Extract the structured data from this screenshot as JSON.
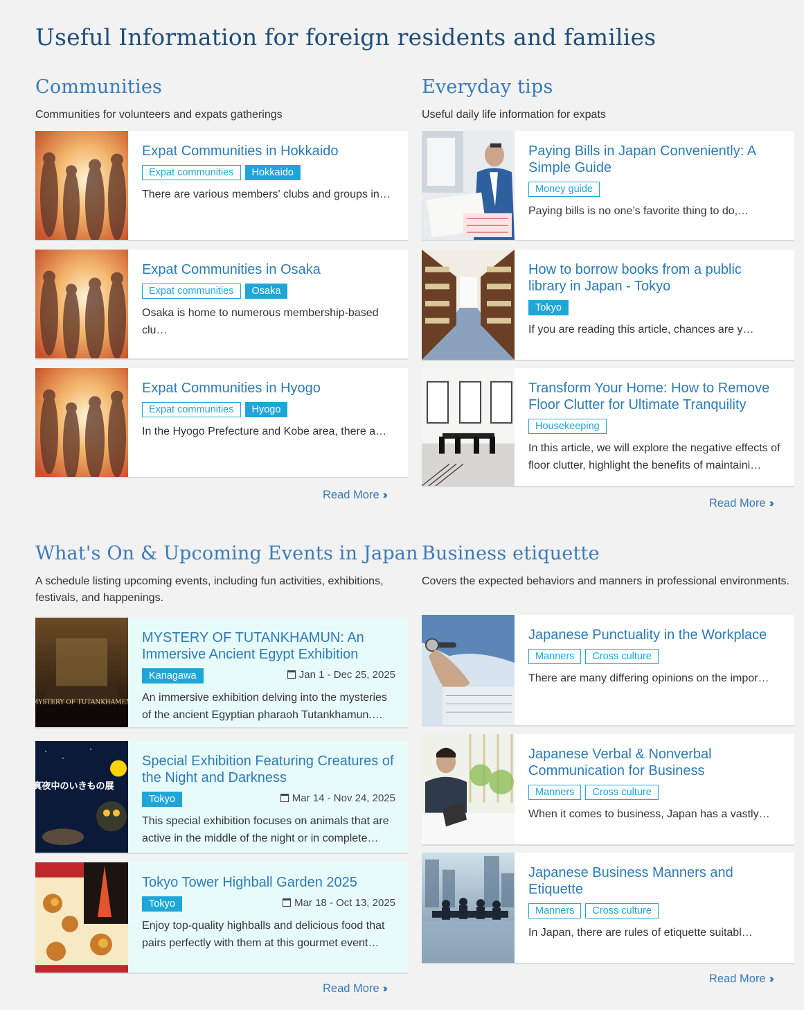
{
  "page": {
    "title": "Useful Information for foreign residents and families"
  },
  "communities": {
    "title": "Communities",
    "desc": "Communities for volunteers and expats gatherings",
    "cards": [
      {
        "title": "Expat Communities in Hokkaido",
        "tags": [
          "Expat communities",
          "Hokkaido"
        ],
        "excerpt": "There are various members' clubs and groups in…"
      },
      {
        "title": "Expat Communities in Osaka",
        "tags": [
          "Expat communities",
          "Osaka"
        ],
        "excerpt": "Osaka is home to numerous membership-based clu…"
      },
      {
        "title": "Expat Communities in Hyogo",
        "tags": [
          "Expat communities",
          "Hyogo"
        ],
        "excerpt": "In the Hyogo Prefecture and Kobe area, there a…"
      }
    ],
    "read_more": "Read More"
  },
  "tips": {
    "title": "Everyday tips",
    "desc": "Useful daily life information for expats",
    "cards": [
      {
        "title": "Paying Bills in Japan Conveniently: A Simple Guide",
        "tags": [
          "Money guide"
        ],
        "excerpt": "Paying bills is no one’s favorite thing to do,…"
      },
      {
        "title": "How to borrow books from a public library in Japan - Tokyo",
        "tags": [
          "Tokyo"
        ],
        "excerpt": "If you are reading this article, chances are y…"
      },
      {
        "title": "Transform Your Home: How to Remove Floor Clutter for Ultimate Tranquility",
        "tags": [
          "Housekeeping"
        ],
        "excerpt": "In this article, we will explore the negative effects of floor clutter, highlight the benefits of maintaini…"
      }
    ],
    "read_more": "Read More"
  },
  "events": {
    "title": "What's On & Upcoming Events in Japan",
    "desc": "A schedule listing upcoming events, including fun activities, exhibitions, festivals, and happenings.",
    "cards": [
      {
        "title": "MYSTERY OF TUTANKHAMUN: An Immersive Ancient Egypt Exhibition",
        "tags": [
          "Kanagawa"
        ],
        "date": "Jan 1 - Dec 25, 2025",
        "excerpt": "An immersive exhibition delving into the mysteries of the ancient Egyptian pharaoh Tutankhamun.…",
        "image_text": "MYSTERY OF TUTANKHAMEN"
      },
      {
        "title": "Special Exhibition Featuring Creatures of the Night and Darkness",
        "tags": [
          "Tokyo"
        ],
        "date": "Mar 14 - Nov 24, 2025",
        "excerpt": "This special exhibition focuses on animals that are active in the middle of the night or in complete…",
        "image_text": "真夜中のいきもの展"
      },
      {
        "title": "Tokyo Tower Highball Garden 2025",
        "tags": [
          "Tokyo"
        ],
        "date": "Mar 18 - Oct 13, 2025",
        "excerpt": "Enjoy top-quality highballs and delicious food that pairs perfectly with them at this gourmet event…"
      }
    ],
    "read_more": "Read More"
  },
  "business": {
    "title": "Business etiquette",
    "desc": "Covers the expected behaviors and manners in professional environments.",
    "cards": [
      {
        "title": "Japanese Punctuality in the Workplace",
        "tags": [
          "Manners",
          "Cross culture"
        ],
        "excerpt": "There are many differing opinions on the impor…"
      },
      {
        "title": "Japanese Verbal & Nonverbal Communication for Business",
        "tags": [
          "Manners",
          "Cross culture"
        ],
        "excerpt": "When it comes to business, Japan has a vastly…"
      },
      {
        "title": "Japanese Business Manners and Etiquette",
        "tags": [
          "Manners",
          "Cross culture"
        ],
        "excerpt": "In Japan, there are rules of etiquette suitabl…"
      }
    ],
    "read_more": "Read More"
  }
}
